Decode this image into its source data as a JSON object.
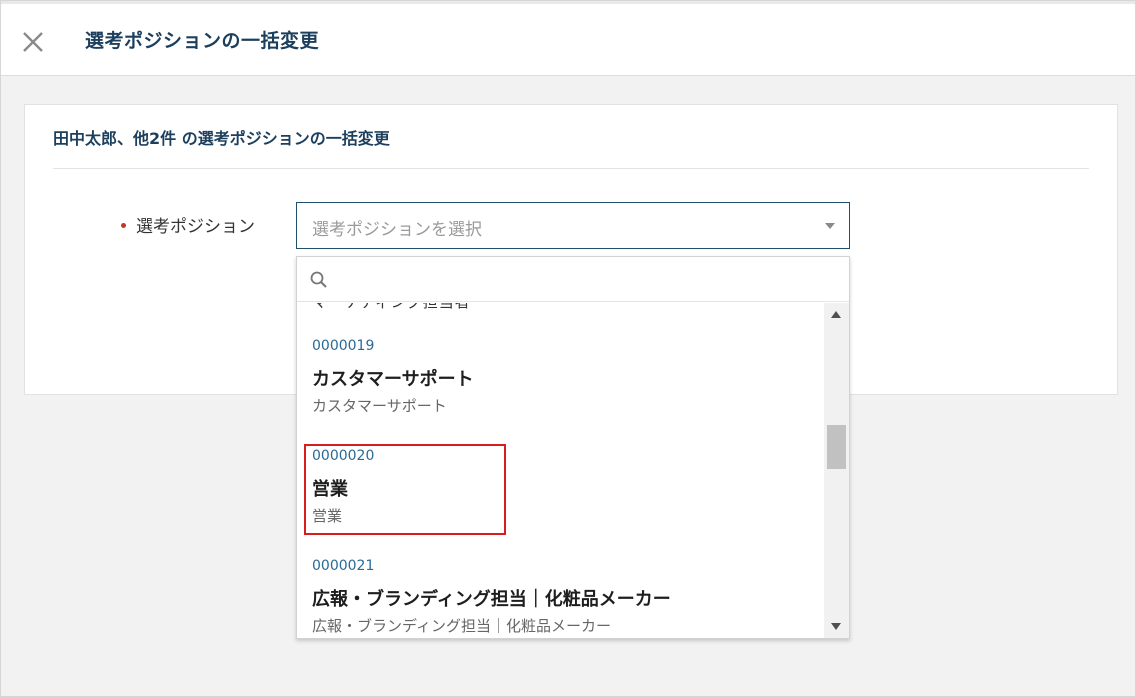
{
  "header": {
    "title": "選考ポジションの一括変更",
    "close_icon": "close-icon"
  },
  "card": {
    "title": "田中太郎、他2件 の選考ポジションの一括変更",
    "field_label": "選考ポジション",
    "select_placeholder": "選考ポジションを選択"
  },
  "dropdown": {
    "search_icon": "search-icon",
    "search_placeholder": "",
    "cutoff_item": "マーケティング担当者",
    "options": [
      {
        "code": "0000019",
        "name": "カスタマーサポート",
        "sub": "カスタマーサポート"
      },
      {
        "code": "0000020",
        "name": "営業",
        "sub": "営業"
      },
      {
        "code": "0000021",
        "name": "広報・ブランディング担当｜化粧品メーカー",
        "sub": "広報・ブランディング担当｜化粧品メーカー"
      }
    ]
  },
  "colors": {
    "title_navy": "#1d3f5e",
    "code_blue": "#2a6a96",
    "required_red": "#c0392b",
    "highlight_red": "#d91c1c"
  }
}
